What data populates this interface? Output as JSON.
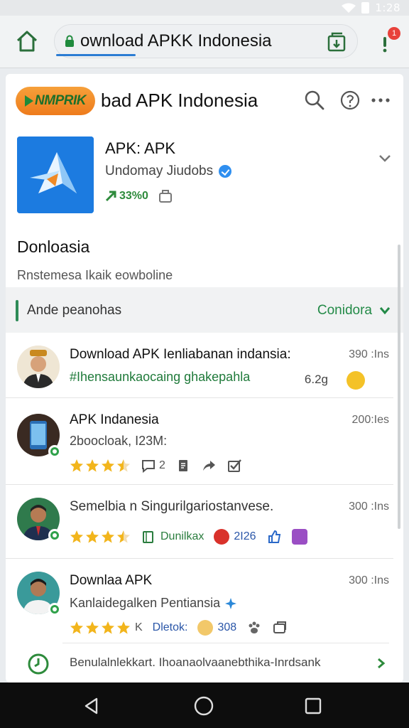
{
  "status_bar": {
    "time": "1:28"
  },
  "browser": {
    "url": "ownload APKK Indonesia",
    "menu_badge": "1"
  },
  "site": {
    "logo_text": "NMPRIK",
    "title": "bad APK Indonesia"
  },
  "app": {
    "name": "APK: APK",
    "developer": "Undomay Jiudobs",
    "downloads": "33%0"
  },
  "download_section": {
    "heading": "Donloasia",
    "subheading": "Rnstemesa Ikaik eowboline"
  },
  "list_header": {
    "title": "Ande peanohas",
    "action_label": "Conidora"
  },
  "items": [
    {
      "title": "Download APK Ienliabanan indansia:",
      "time": "390 :Ins",
      "subtitle": "#Ihensaunkaocaing ghakepahla",
      "size": "6.2g"
    },
    {
      "title": "APK Indanesia",
      "time": "200:Ies",
      "subtitle": "2boocloak, I23M:",
      "rating": 3.5,
      "comments": "2"
    },
    {
      "title": "Semelbia n Singurilgariostanvese.",
      "time": "300 :Ins",
      "rating": 3.5,
      "tag_label": "Dunilkax",
      "badge_count": "2I26"
    },
    {
      "title": "Downlaa APK",
      "time": "300 :Ins",
      "subtitle": "Kanlaidegalken Pentiansia",
      "rating": 4.5,
      "rating_suffix": "K",
      "tag_label": "Dletok:",
      "badge_count": "308"
    }
  ],
  "footer": {
    "text": "Benulalnlekkart. Ihoanaolvaanebthika-Inrdsank"
  },
  "colors": {
    "accent_green": "#2e8b57",
    "brand_orange": "#f08a26",
    "app_blue": "#1c7be0"
  }
}
